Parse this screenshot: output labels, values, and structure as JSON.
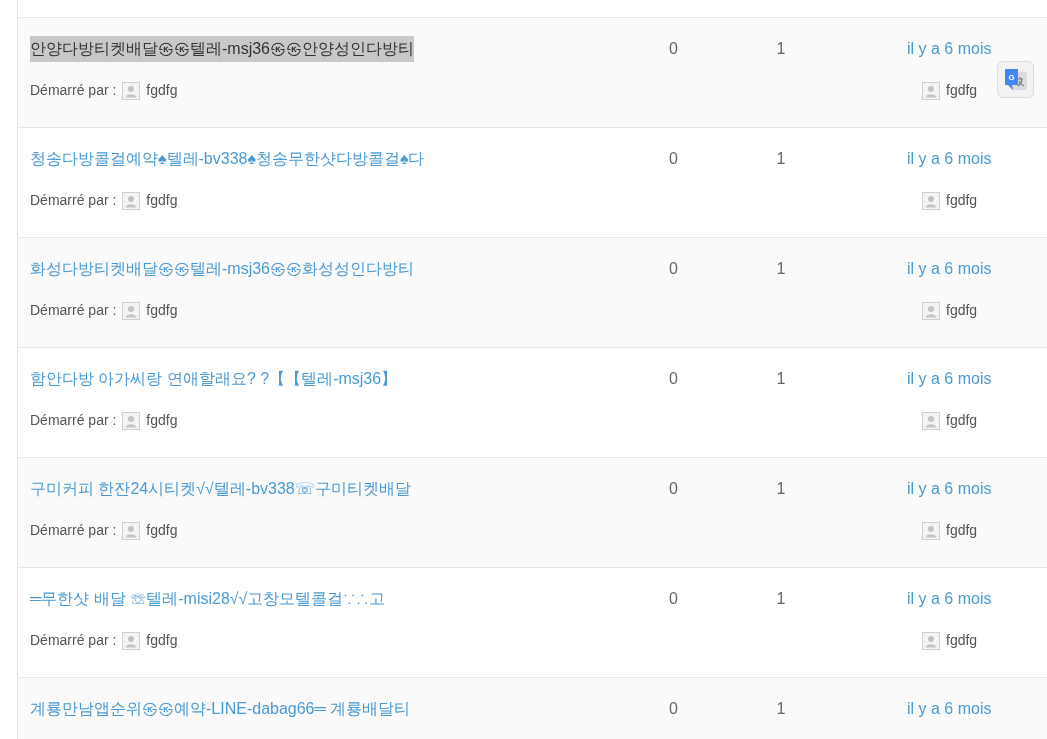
{
  "translate_logo_letter": "G",
  "topics": [
    {
      "title": "안양다방티켓배달㉿㉿텔레-msj36㉿㉿안양성인다방티",
      "highlighted": true,
      "started_by_label": "Démarré par :",
      "author": "fgdfg",
      "replies": "0",
      "views": "1",
      "last_post_time": "il y a 6 mois",
      "last_post_author": "fgdfg"
    },
    {
      "title": "청송다방콜걸예약♠텔레-bv338♠청송무한샷다방콜걸♠다",
      "highlighted": false,
      "started_by_label": "Démarré par :",
      "author": "fgdfg",
      "replies": "0",
      "views": "1",
      "last_post_time": "il y a 6 mois",
      "last_post_author": "fgdfg"
    },
    {
      "title": "화성다방티켓배달㉿㉿텔레-msj36㉿㉿화성성인다방티",
      "highlighted": false,
      "started_by_label": "Démarré par :",
      "author": "fgdfg",
      "replies": "0",
      "views": "1",
      "last_post_time": "il y a 6 mois",
      "last_post_author": "fgdfg"
    },
    {
      "title": "함안다방 아가씨랑 연애할래요? ?【【텔레-msj36】",
      "highlighted": false,
      "started_by_label": "Démarré par :",
      "author": "fgdfg",
      "replies": "0",
      "views": "1",
      "last_post_time": "il y a 6 mois",
      "last_post_author": "fgdfg"
    },
    {
      "title": "구미커피 한잔24시티켓√√텔레-bv338☏구미티켓배달",
      "highlighted": false,
      "started_by_label": "Démarré par :",
      "author": "fgdfg",
      "replies": "0",
      "views": "1",
      "last_post_time": "il y a 6 mois",
      "last_post_author": "fgdfg"
    },
    {
      "title": "═무한샷 배달 ☏텔레-misi28√√고창모텔콜걸∵∴고",
      "highlighted": false,
      "started_by_label": "Démarré par :",
      "author": "fgdfg",
      "replies": "0",
      "views": "1",
      "last_post_time": "il y a 6 mois",
      "last_post_author": "fgdfg"
    },
    {
      "title": "계룡만남앱순위㉿㉿예약-LINE-dabag66═ 계룡배달티",
      "highlighted": false,
      "replies": "0",
      "views": "1",
      "last_post_time": "il y a 6 mois"
    }
  ]
}
